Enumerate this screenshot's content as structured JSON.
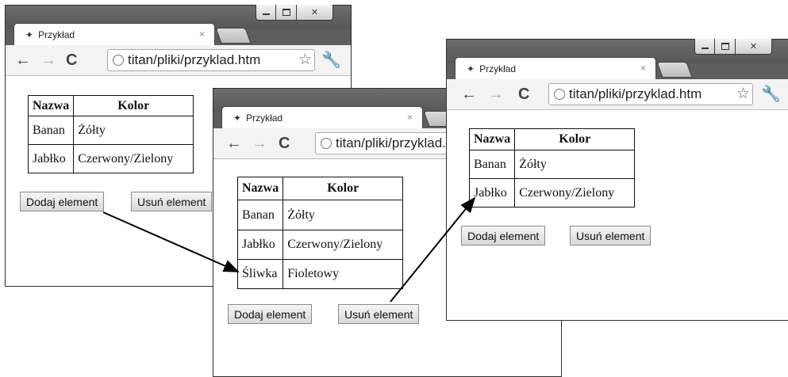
{
  "tab_title": "Przykład",
  "tab_close": "×",
  "url": "titan/pliki/przyklad.htm",
  "icons": [
    "favicon-icon",
    "back-icon",
    "forward-icon",
    "reload-icon",
    "globe-icon",
    "star-icon",
    "wrench-icon",
    "minimize-icon",
    "maximize-icon",
    "close-icon"
  ],
  "table_headers": [
    "Nazwa",
    "Kolor"
  ],
  "windows": {
    "initial": {
      "rows": [
        [
          "Banan",
          "Żółty"
        ],
        [
          "Jabłko",
          "Czerwony/Zielony"
        ]
      ],
      "add_button": "Dodaj element",
      "remove_button": "Usuń element"
    },
    "after_add": {
      "rows": [
        [
          "Banan",
          "Żółty"
        ],
        [
          "Jabłko",
          "Czerwony/Zielony"
        ],
        [
          "Śliwka",
          "Fioletowy"
        ]
      ],
      "add_button": "Dodaj element",
      "remove_button": "Usuń element"
    },
    "after_remove": {
      "rows": [
        [
          "Banan",
          "Żółty"
        ],
        [
          "Jabłko",
          "Czerwony/Zielony"
        ]
      ],
      "add_button": "Dodaj element",
      "remove_button": "Usuń element"
    }
  },
  "colors": {
    "frame": "#5e5e5e",
    "toolbar": "#f3f3f3",
    "content": "#ffffff",
    "arrow": "#000000"
  }
}
